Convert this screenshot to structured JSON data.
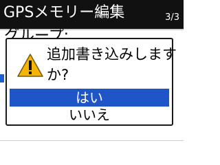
{
  "header": {
    "title": "GPSメモリー編集",
    "page": "3/3"
  },
  "list": {
    "group_label": "グループ:"
  },
  "dialog": {
    "message_line1": "追加書き込みします",
    "message_line2": "か?",
    "yes_label": "はい",
    "no_label": "いいえ",
    "icon": "warning-icon"
  },
  "colors": {
    "title_bg": "#111111",
    "selection": "#1e56c8",
    "warning_yellow": "#f5b400"
  }
}
